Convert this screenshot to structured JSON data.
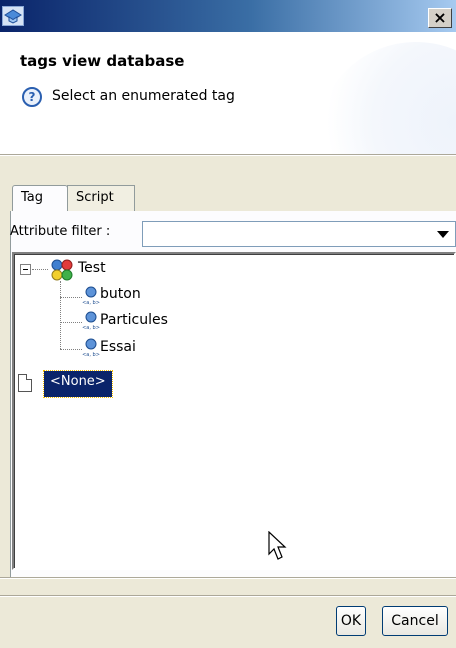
{
  "window": {
    "close_label": "×"
  },
  "header": {
    "title": "tags view database",
    "message": "Select an enumerated tag",
    "help_glyph": "?"
  },
  "tabs": [
    {
      "label": "Tag",
      "selected": true
    },
    {
      "label": "Script",
      "selected": false
    }
  ],
  "filter": {
    "label": "Attribute filter :",
    "value": ""
  },
  "tree": {
    "root": {
      "label": "Test",
      "expanded": true
    },
    "children": [
      {
        "label": "buton"
      },
      {
        "label": "Particules"
      },
      {
        "label": "Essai"
      }
    ],
    "none_item": {
      "label": "<None>",
      "selected": true
    },
    "attr_icon_caption": "<a, b>"
  },
  "buttons": {
    "ok": "OK",
    "cancel": "Cancel"
  },
  "colors": {
    "selection": "#0a246a",
    "title_gradient_start": "#0a246a"
  }
}
